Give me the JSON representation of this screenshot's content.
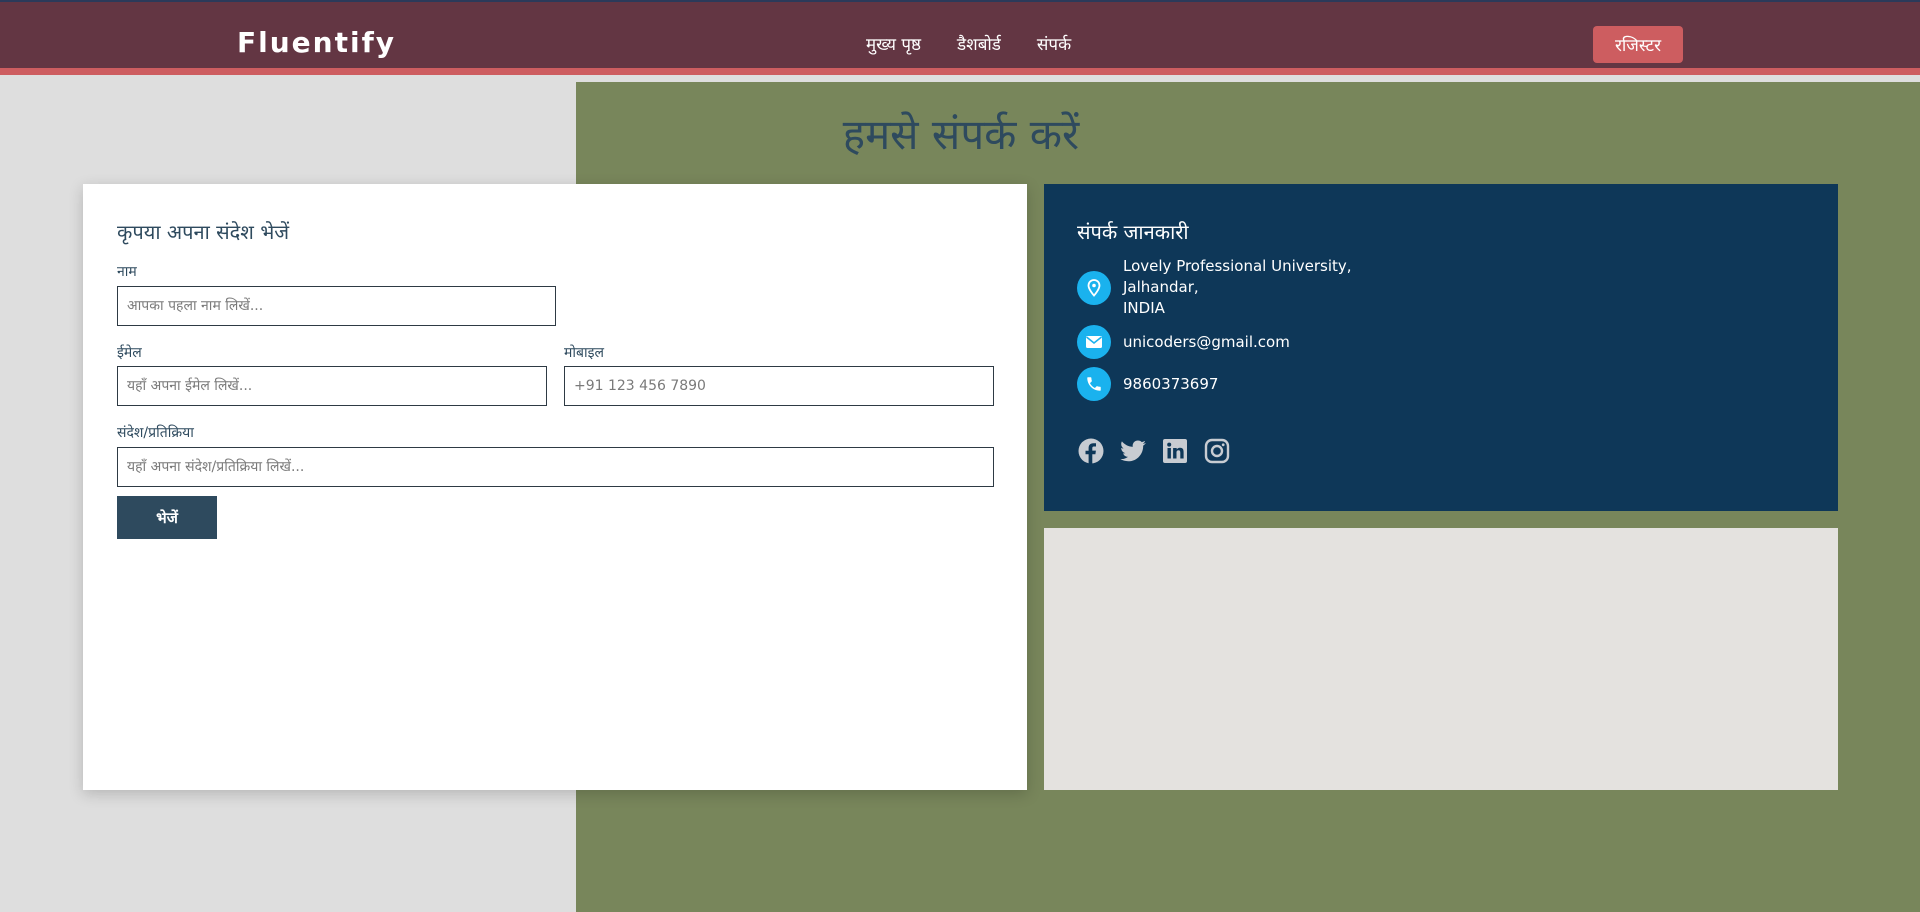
{
  "nav": {
    "logo": "Fluentify",
    "links": [
      "मुख्य पृष्ठ",
      "डैशबोर्ड",
      "संपर्क"
    ],
    "register": "रजिस्टर"
  },
  "page": {
    "title": "हमसे संपर्क करें"
  },
  "form": {
    "heading": "कृपया अपना संदेश भेजें",
    "name_label": "नाम",
    "name_placeholder": "आपका पहला नाम लिखें...",
    "email_label": "ईमेल",
    "email_placeholder": "यहाँ अपना ईमेल लिखें...",
    "mobile_label": "मोबाइल",
    "mobile_placeholder": "+91 123 456 7890",
    "message_label": "संदेश/प्रतिक्रिया",
    "message_placeholder": "यहाँ अपना संदेश/प्रतिक्रिया लिखें...",
    "send": "भेजें"
  },
  "contact": {
    "heading": "संपर्क जानकारी",
    "address_line1": "Lovely Professional University,",
    "address_line2": "Jalhandar,",
    "address_line3": "INDIA",
    "email": "unicoders@gmail.com",
    "phone": "9860373697",
    "icons": [
      "location-icon",
      "mail-icon",
      "phone-icon"
    ],
    "social": [
      "facebook-icon",
      "twitter-icon",
      "linkedin-icon",
      "instagram-icon"
    ]
  },
  "colors": {
    "navbar": "#633643",
    "accent": "#cd5d60",
    "green": "#78865b",
    "info_card": "#0e3758",
    "icon_bg": "#1ab2ee",
    "heading_text": "#2e4a5e"
  }
}
